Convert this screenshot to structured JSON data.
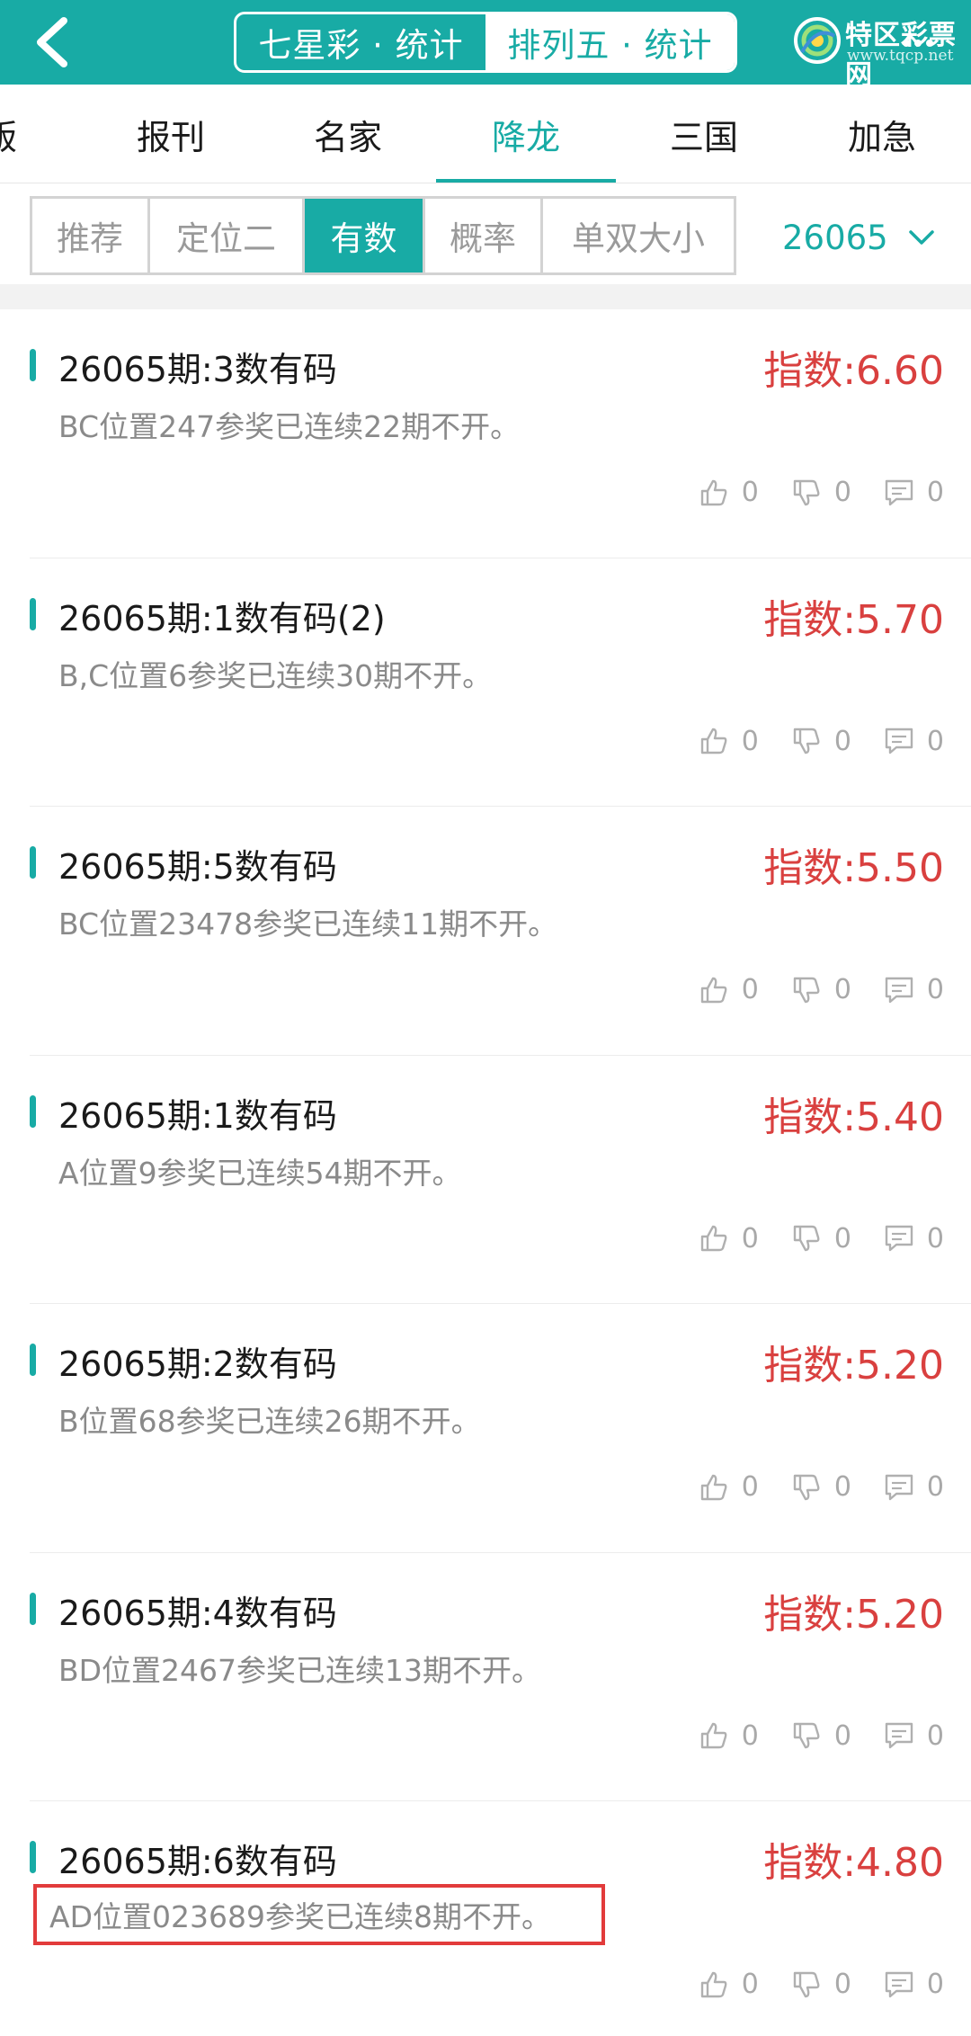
{
  "header": {
    "back_icon": "chevron-left-icon",
    "segments": [
      {
        "label": "七星彩 · 统计",
        "active": false
      },
      {
        "label": "排列五 · 统计",
        "active": true
      }
    ],
    "logo_text": "特区彩票网",
    "logo_url": "www.tqcp.net"
  },
  "tabs": [
    {
      "label": "版",
      "active": false
    },
    {
      "label": "报刊",
      "active": false
    },
    {
      "label": "名家",
      "active": false
    },
    {
      "label": "降龙",
      "active": true
    },
    {
      "label": "三国",
      "active": false
    },
    {
      "label": "加急",
      "active": false
    }
  ],
  "filters": {
    "chips": [
      {
        "label": "推荐",
        "active": false
      },
      {
        "label": "定位二",
        "active": false
      },
      {
        "label": "有数",
        "active": true
      },
      {
        "label": "概率",
        "active": false
      },
      {
        "label": "单双大小",
        "active": false
      }
    ],
    "period": "26065"
  },
  "colors": {
    "accent": "#18aba5",
    "index_red": "#d9403f",
    "highlight_box": "#e23b3b"
  },
  "items": [
    {
      "title": "26065期:3数有码",
      "index": "指数:6.60",
      "desc": "BC位置247参奖已连续22期不开。",
      "likes": "0",
      "dislikes": "0",
      "comments": "0"
    },
    {
      "title": "26065期:1数有码(2)",
      "index": "指数:5.70",
      "desc": "B,C位置6参奖已连续30期不开。",
      "likes": "0",
      "dislikes": "0",
      "comments": "0"
    },
    {
      "title": "26065期:5数有码",
      "index": "指数:5.50",
      "desc": "BC位置23478参奖已连续11期不开。",
      "likes": "0",
      "dislikes": "0",
      "comments": "0"
    },
    {
      "title": "26065期:1数有码",
      "index": "指数:5.40",
      "desc": "A位置9参奖已连续54期不开。",
      "likes": "0",
      "dislikes": "0",
      "comments": "0"
    },
    {
      "title": "26065期:2数有码",
      "index": "指数:5.20",
      "desc": "B位置68参奖已连续26期不开。",
      "likes": "0",
      "dislikes": "0",
      "comments": "0"
    },
    {
      "title": "26065期:4数有码",
      "index": "指数:5.20",
      "desc": "BD位置2467参奖已连续13期不开。",
      "likes": "0",
      "dislikes": "0",
      "comments": "0"
    },
    {
      "title": "26065期:6数有码",
      "index": "指数:4.80",
      "desc": "AD位置023689参奖已连续8期不开。",
      "likes": "0",
      "dislikes": "0",
      "comments": "0",
      "highlighted": true
    }
  ]
}
